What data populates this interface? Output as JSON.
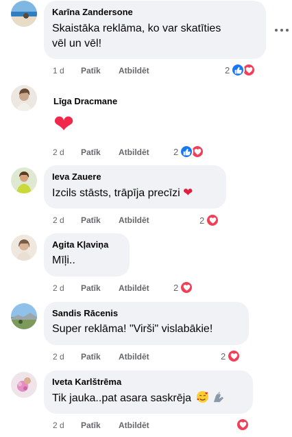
{
  "comments": [
    {
      "author": "Karīna Zandersone",
      "text": "Skaistāka reklāma, ko var skatīties",
      "text2": "vēl un vēl!",
      "time": "1 d",
      "like": "Patīk",
      "reply": "Atbildēt",
      "reactions": "2"
    },
    {
      "author": "Līga Dracmane",
      "text": "",
      "sticker": "❤",
      "time": "2 d",
      "like": "Patīk",
      "reply": "Atbildēt",
      "reactions": "2"
    },
    {
      "author": "Ieva Zauere",
      "text": "Izcils stāsts, trāpīja precīzi",
      "time": "2 d",
      "like": "Patīk",
      "reply": "Atbildēt",
      "reactions": "2"
    },
    {
      "author": "Agita Kļaviņa",
      "text": "Mīļi..",
      "time": "2 d",
      "like": "Patīk",
      "reply": "Atbildēt",
      "reactions": "2"
    },
    {
      "author": "Sandis Rācenis",
      "text": "Super reklāma! \"Virši\" vislabākie!",
      "time": "2 d",
      "like": "Patīk",
      "reply": "Atbildēt",
      "reactions": "2"
    },
    {
      "author": "Iveta Karlštrēma",
      "text": "Tik jauka..pat asara saskrēja",
      "emoji": "🥰",
      "time": "2 d",
      "like": "Patīk",
      "reply": "Atbildēt",
      "reactions": ""
    }
  ],
  "colors": {
    "bubble": "#f0f2f5",
    "like_blue": "#1877f2",
    "love_red": "#f33e58",
    "meta_gray": "#65676b"
  },
  "icons": {
    "like": "thumbs-up-icon",
    "love": "heart-icon",
    "more": "more-options-icon"
  }
}
